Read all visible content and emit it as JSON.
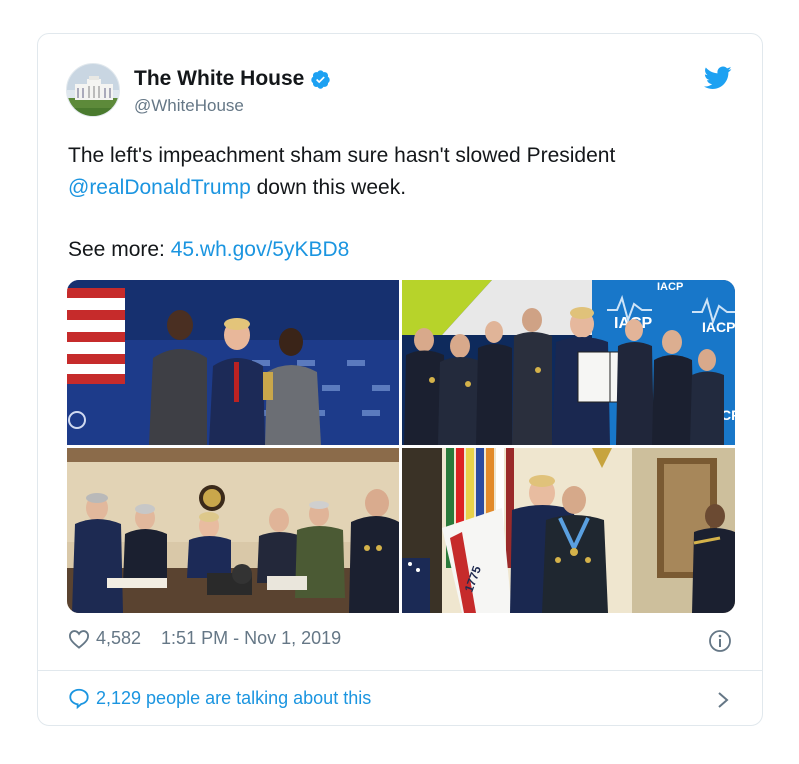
{
  "tweet": {
    "display_name": "The White House",
    "handle": "@WhiteHouse",
    "text_before_mention": "The left's impeachment sham sure hasn't slowed President",
    "mention": "@realDonaldTrump",
    "text_after_mention": " down this week.",
    "see_more_label": "See more: ",
    "see_more_link": "45.wh.gov/5yKBD8",
    "likes": "4,582",
    "timestamp": "1:51 PM - Nov 1, 2019",
    "talking": "2,129 people are talking about this"
  },
  "icons": {
    "verified": "verified-badge-icon",
    "brand": "twitter-bird-icon",
    "like": "heart-icon",
    "info": "info-icon",
    "reply": "speech-bubble-icon",
    "chevron": "chevron-right-icon"
  },
  "colors": {
    "accent": "#1b95e0",
    "text_primary": "#14171a",
    "text_secondary": "#657786",
    "border": "#e1e8ed"
  },
  "photos": [
    {
      "name": "photo-award-ceremony"
    },
    {
      "name": "photo-iacp-bill-signing"
    },
    {
      "name": "photo-situation-room"
    },
    {
      "name": "photo-medal-of-honor"
    }
  ],
  "photo_text": {
    "iacp": "IACP",
    "flag_year": "1775"
  }
}
